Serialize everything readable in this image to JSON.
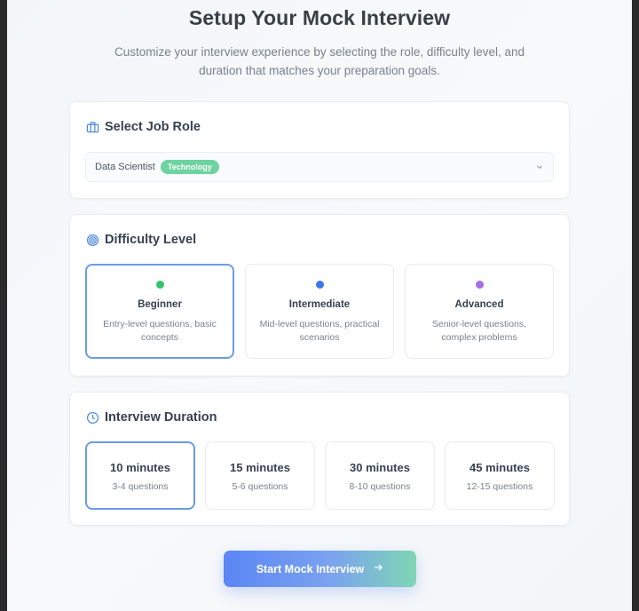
{
  "header": {
    "title": "Setup Your Mock Interview",
    "subtitle": "Customize your interview experience by selecting the role, difficulty level, and duration that matches your preparation goals."
  },
  "job_role": {
    "heading": "Select Job Role",
    "icon": "briefcase-icon",
    "selected_role": "Data Scientist",
    "selected_category": "Technology",
    "category_color": "#6dd3a0"
  },
  "difficulty": {
    "heading": "Difficulty Level",
    "icon": "target-icon",
    "options": [
      {
        "label": "Beginner",
        "description": "Entry-level questions, basic concepts",
        "color": "#34c36b",
        "selected": true
      },
      {
        "label": "Intermediate",
        "description": "Mid-level questions, practical scenarios",
        "color": "#3b78e7",
        "selected": false
      },
      {
        "label": "Advanced",
        "description": "Senior-level questions, complex problems",
        "color": "#a56ee8",
        "selected": false
      }
    ]
  },
  "duration": {
    "heading": "Interview Duration",
    "icon": "clock-icon",
    "options": [
      {
        "label": "10 minutes",
        "description": "3-4 questions",
        "selected": true
      },
      {
        "label": "15 minutes",
        "description": "5-6 questions",
        "selected": false
      },
      {
        "label": "30 minutes",
        "description": "8-10 questions",
        "selected": false
      },
      {
        "label": "45 minutes",
        "description": "12-15 questions",
        "selected": false
      }
    ]
  },
  "actions": {
    "start_label": "Start Mock Interview",
    "start_icon": "arrow-right-icon"
  },
  "colors": {
    "accent": "#6b9be6",
    "heading_text": "#374151",
    "muted_text": "#7a818b"
  }
}
